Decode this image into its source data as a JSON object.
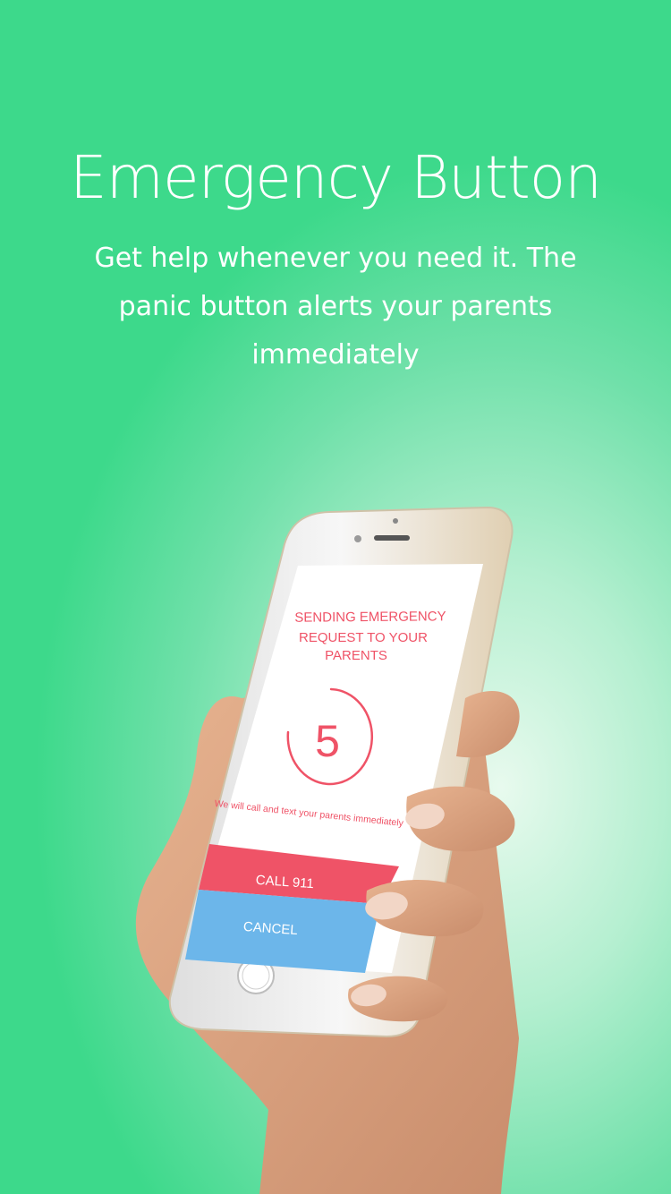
{
  "header": {
    "title": "Emergency Button",
    "subtitle": "Get help whenever you need it. The panic button alerts your parents immediately"
  },
  "phone_screen": {
    "status_title_line1": "SENDING EMERGENCY",
    "status_title_line2": "REQUEST TO YOUR",
    "status_title_line3": "PARENTS",
    "countdown": "5",
    "note": "We will call and text your parents immediately",
    "call_button_label": "CALL 911",
    "cancel_button_label": "CANCEL"
  },
  "colors": {
    "background": "#3dd98b",
    "accent_red": "#ef5367",
    "cancel_blue": "#6cb6ea",
    "text_white": "#ffffff"
  }
}
